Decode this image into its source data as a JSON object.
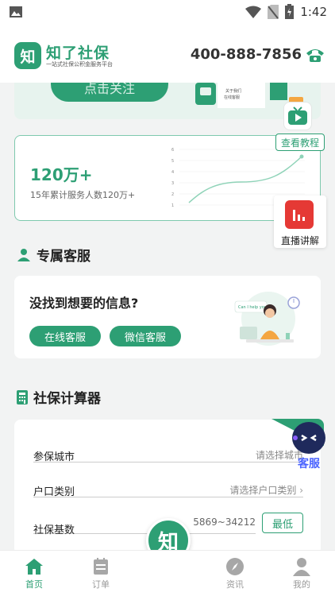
{
  "status_bar": {
    "time": "1:42"
  },
  "header": {
    "logo_char": "知",
    "brand_name": "知了社保",
    "slogan": "一站式社保公积金服务平台",
    "phone": "400-888-7856",
    "phone_icon": "phone-icon"
  },
  "banner": {
    "button_label": "点击关注",
    "art_lines": [
      "关于我们",
      "在线客服"
    ]
  },
  "stats": {
    "value": "120万+",
    "description": "15年累计服务人数120万+",
    "chart_ticks": [
      "6",
      "5",
      "4",
      "3",
      "2",
      "1"
    ],
    "tutorial_label": "查看教程",
    "live_label": "直播讲解"
  },
  "service": {
    "section_title": "专属客服",
    "question": "没找到想要的信息?",
    "online_label": "在线客服",
    "wechat_label": "微信客服",
    "illus_text": "Can I help you?"
  },
  "calculator": {
    "section_title": "社保计算器",
    "rows": [
      {
        "label": "参保城市",
        "value": "请选择城市"
      },
      {
        "label": "户口类别",
        "value": "请选择户口类别"
      },
      {
        "label": "社保基数",
        "value": "5869~34212"
      }
    ],
    "min_label": "最低",
    "kefu_label": "客服"
  },
  "fab": {
    "label": "知"
  },
  "tabs": [
    {
      "label": "首页",
      "icon": "home-icon",
      "active": true
    },
    {
      "label": "订单",
      "icon": "orders-icon",
      "active": false
    },
    {
      "label": "资讯",
      "icon": "compass-icon",
      "active": false
    },
    {
      "label": "我的",
      "icon": "profile-icon",
      "active": false
    }
  ],
  "colors": {
    "brand": "#2d9f74",
    "accent_blue": "#4a63ff",
    "live_red": "#e53935"
  }
}
